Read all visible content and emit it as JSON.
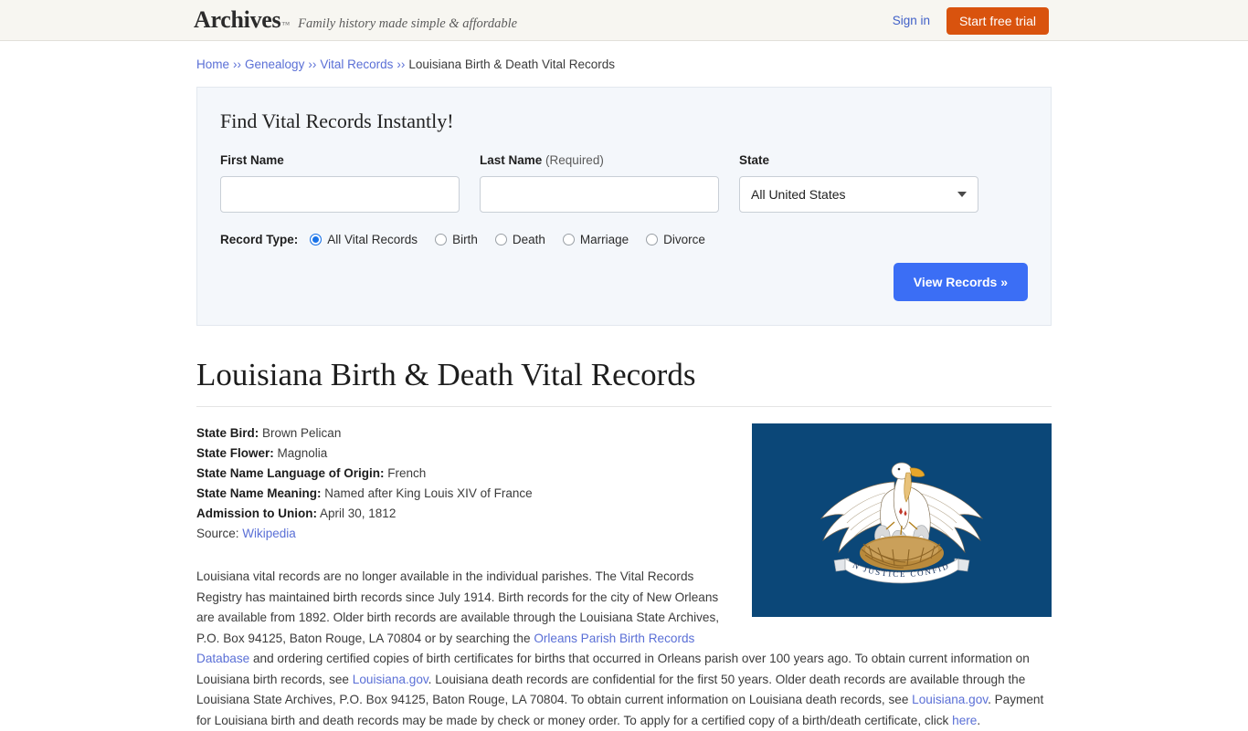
{
  "header": {
    "logo": "Archives",
    "trademark": "™",
    "tagline": "Family history made simple & affordable",
    "signin_label": "Sign in",
    "trial_label": "Start free trial",
    "accent_orange": "#d9530e",
    "link_blue": "#4060c8"
  },
  "breadcrumb": {
    "separator": "››",
    "items": [
      {
        "label": "Home",
        "link": true
      },
      {
        "label": "Genealogy",
        "link": true
      },
      {
        "label": "Vital Records",
        "link": true
      },
      {
        "label": "Louisiana Birth & Death Vital Records",
        "link": false
      }
    ]
  },
  "search_panel": {
    "title": "Find Vital Records Instantly!",
    "first_name": {
      "label": "First Name",
      "value": "",
      "placeholder": ""
    },
    "last_name": {
      "label": "Last Name",
      "required_note": "(Required)",
      "value": "",
      "placeholder": ""
    },
    "state": {
      "label": "State",
      "selected": "All United States"
    },
    "record_type": {
      "label": "Record Type:",
      "options": [
        {
          "label": "All Vital Records",
          "selected": true
        },
        {
          "label": "Birth",
          "selected": false
        },
        {
          "label": "Death",
          "selected": false
        },
        {
          "label": "Marriage",
          "selected": false
        },
        {
          "label": "Divorce",
          "selected": false
        }
      ]
    },
    "submit_label": "View Records »",
    "submit_color": "#3b6ef5"
  },
  "page_title": "Louisiana Birth & Death Vital Records",
  "facts": [
    {
      "label": "State Bird:",
      "value": "Brown Pelican"
    },
    {
      "label": "State Flower:",
      "value": "Magnolia"
    },
    {
      "label": "State Name Language of Origin:",
      "value": "French"
    },
    {
      "label": "State Name Meaning:",
      "value": "Named after King Louis XIV of France"
    },
    {
      "label": "Admission to Union:",
      "value": "April 30, 1812"
    }
  ],
  "source": {
    "label": "Source:",
    "link_text": "Wikipedia"
  },
  "flag": {
    "name": "louisiana-state-flag",
    "field_color": "#0b4778",
    "motto": "UNION JUSTICE CONFIDENCE"
  },
  "body": {
    "p1_a": "Louisiana vital records are no longer available in the individual parishes. The Vital Records Registry has maintained birth records since July 1914. Birth records for the city of New Orleans are available from 1892. Older birth records are available through the Louisiana State Archives, P.O. Box 94125, Baton Rouge, LA 70804 or by searching the ",
    "link1": "Orleans Parish Birth Records Database",
    "p1_b": " and ordering certified copies of birth certificates for births that occurred in Orleans parish over 100 years ago. To obtain current information on Louisiana birth records, see ",
    "link2": "Louisiana.gov",
    "p1_c": ". Louisiana death records are confidential for the first 50 years. Older death records are available through the Louisiana State Archives, P.O. Box 94125, Baton Rouge, LA 70804. To obtain current information on Louisiana death records, see ",
    "link3": "Louisiana.gov",
    "p1_d": ". Payment for Louisiana birth and death records may be made by check or money order. To apply for a certified copy of a birth/death certificate, click ",
    "link4": "here",
    "p1_e": "."
  }
}
